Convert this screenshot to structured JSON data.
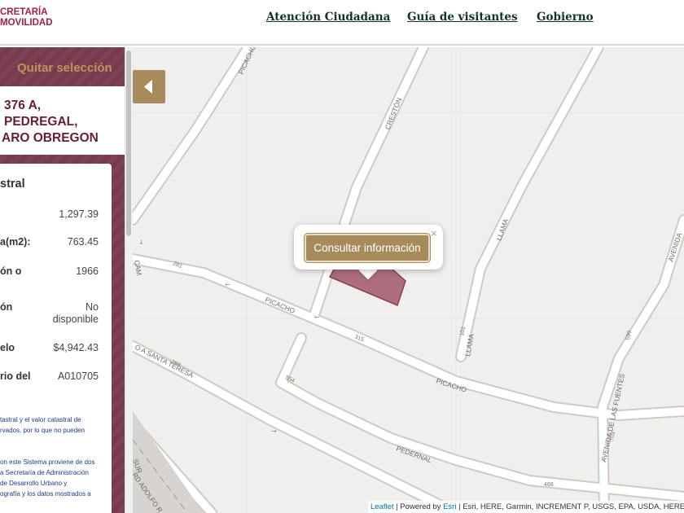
{
  "header": {
    "logo_line1": "CRETARÍA",
    "logo_line2": "MOVILIDAD",
    "nav": [
      "Atención Ciudadana",
      "Guía de visitantes",
      "Gobierno"
    ]
  },
  "sidebar": {
    "quitar_label": "Quitar selección",
    "address": [
      "376 A,",
      "PEDREGAL,",
      "ARO OBREGON"
    ],
    "section_title": "stral",
    "rows": [
      {
        "label": "",
        "value": "1,297.39"
      },
      {
        "label": "a(m2):",
        "value": "763.45"
      },
      {
        "label": "ón o",
        "value": "1966"
      },
      {
        "label": "ón",
        "value": "No disponible"
      },
      {
        "label": "elo",
        "value": "$4,942.43"
      },
      {
        "label": "rio del",
        "value": "A010705"
      }
    ],
    "note1": [
      "tastral y el valor catastral de",
      "rvados, por lo que no pueden"
    ],
    "note2": [
      "on este Sistema proviene de dos",
      "a Secretaría de Administración",
      "de Desarrollo Urbano y",
      "ografía y los datos mostrados a"
    ]
  },
  "map": {
    "streets": [
      "PICACHO",
      "CRESTÓN",
      "LLAMA",
      "PICACHO",
      "PICACHO",
      "LLAMA",
      "AVENIDA DE LAS FUENTES",
      "AVENIDA",
      "PEDERNAL",
      "O A SANTA TERESA",
      "SUR",
      "RD ADOLFO R",
      "CAM"
    ],
    "numbers": [
      "281",
      "315",
      "101",
      "599",
      "298",
      "554",
      "703",
      "468"
    ],
    "popup_button": "Consultar información",
    "popup_close": "×",
    "attribution": {
      "leaflet": "Leaflet",
      "powered": " | Powered by ",
      "esri": "Esri",
      "rest": " | Esri, HERE, Garmin, INCREMENT P, USGS, EPA, USDA, HERE, De"
    }
  },
  "colors": {
    "brand": "#9f2241",
    "sidebar_bg": "#7b3b4e",
    "gold": "#a88b5d",
    "parcel": "#9c4d62"
  }
}
